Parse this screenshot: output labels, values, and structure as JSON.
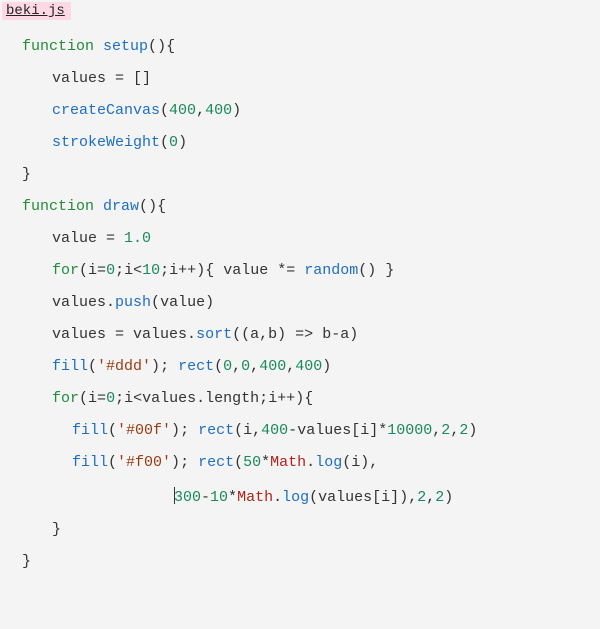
{
  "file": {
    "name": "beki.js"
  },
  "kw": {
    "function": "function",
    "for": "for"
  },
  "fn": {
    "setup": "setup",
    "draw": "draw",
    "createCanvas": "createCanvas",
    "strokeWeight": "strokeWeight",
    "random": "random",
    "push": "push",
    "sort": "sort",
    "fill": "fill",
    "rect": "rect",
    "log": "log"
  },
  "id": {
    "values": "values",
    "value": "value",
    "i": "i",
    "a": "a",
    "b": "b",
    "Math": "Math",
    "length": "length"
  },
  "num": {
    "n0": "0",
    "n1": "1",
    "n2": "2",
    "n10": "10",
    "n50": "50",
    "n300": "300",
    "n400": "400",
    "n10000": "10000",
    "f1_0": "1.0"
  },
  "str": {
    "ddd": "'#ddd'",
    "blue": "'#00f'",
    "red": "'#f00'"
  },
  "sym": {
    "lpar": "(",
    "rpar": ")",
    "lbr": "{",
    "rbr": "}",
    "lbrk": "[",
    "rbrk": "]",
    "semi": ";",
    "comma": ",",
    "dot": ".",
    "eq": " = ",
    "eqn": "=",
    "lt": "<",
    "inc": "++",
    "arrow": " => ",
    "minus": "-",
    "star": "*",
    "stareq": " *= ",
    "sp": " "
  }
}
